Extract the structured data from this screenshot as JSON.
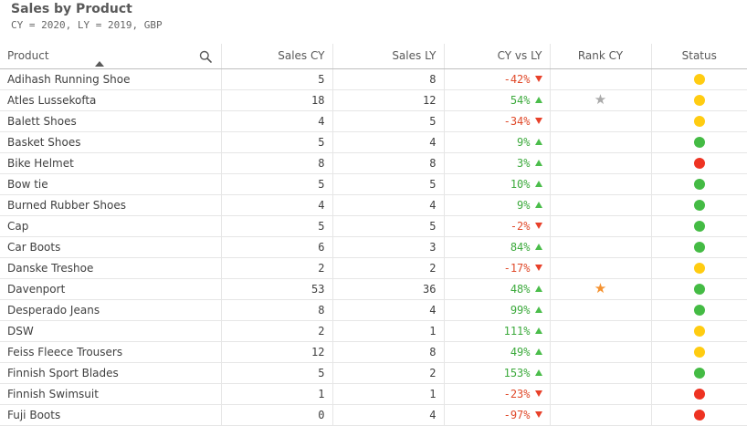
{
  "header": {
    "title": "Sales by Product",
    "subtitle": "CY = 2020, LY = 2019, GBP"
  },
  "columns": [
    "Product",
    "Sales CY",
    "Sales LY",
    "CY vs LY",
    "Rank CY",
    "Status"
  ],
  "icons": {
    "search": "search-icon",
    "sort": "sort-ascending-icon",
    "up": "triangle-up-icon",
    "down": "triangle-down-icon",
    "star": "star-icon"
  },
  "colors": {
    "positive": "#3daa3d",
    "negative": "#e04a2a",
    "status_green": "#44bb44",
    "status_yellow": "#ffcc11",
    "status_red": "#ee3322",
    "star_gold": "#f59230",
    "star_gray": "#aaaaaa"
  },
  "rows": [
    {
      "product": "Adihash Running Shoe",
      "cy": "5",
      "ly": "8",
      "delta": "-42%",
      "trend": "down",
      "rank": "",
      "status": "yellow"
    },
    {
      "product": "Atles Lussekofta",
      "cy": "18",
      "ly": "12",
      "delta": "54%",
      "trend": "up",
      "rank": "gray",
      "status": "yellow"
    },
    {
      "product": "Balett Shoes",
      "cy": "4",
      "ly": "5",
      "delta": "-34%",
      "trend": "down",
      "rank": "",
      "status": "yellow"
    },
    {
      "product": "Basket Shoes",
      "cy": "5",
      "ly": "4",
      "delta": "9%",
      "trend": "up",
      "rank": "",
      "status": "green"
    },
    {
      "product": "Bike Helmet",
      "cy": "8",
      "ly": "8",
      "delta": "3%",
      "trend": "up",
      "rank": "",
      "status": "red"
    },
    {
      "product": "Bow tie",
      "cy": "5",
      "ly": "5",
      "delta": "10%",
      "trend": "up",
      "rank": "",
      "status": "green"
    },
    {
      "product": "Burned Rubber Shoes",
      "cy": "4",
      "ly": "4",
      "delta": "9%",
      "trend": "up",
      "rank": "",
      "status": "green"
    },
    {
      "product": "Cap",
      "cy": "5",
      "ly": "5",
      "delta": "-2%",
      "trend": "down",
      "rank": "",
      "status": "green"
    },
    {
      "product": "Car Boots",
      "cy": "6",
      "ly": "3",
      "delta": "84%",
      "trend": "up",
      "rank": "",
      "status": "green"
    },
    {
      "product": "Danske Treshoe",
      "cy": "2",
      "ly": "2",
      "delta": "-17%",
      "trend": "down",
      "rank": "",
      "status": "yellow"
    },
    {
      "product": "Davenport",
      "cy": "53",
      "ly": "36",
      "delta": "48%",
      "trend": "up",
      "rank": "gold",
      "status": "green"
    },
    {
      "product": "Desperado Jeans",
      "cy": "8",
      "ly": "4",
      "delta": "99%",
      "trend": "up",
      "rank": "",
      "status": "green"
    },
    {
      "product": "DSW",
      "cy": "2",
      "ly": "1",
      "delta": "111%",
      "trend": "up",
      "rank": "",
      "status": "yellow"
    },
    {
      "product": "Feiss Fleece Trousers",
      "cy": "12",
      "ly": "8",
      "delta": "49%",
      "trend": "up",
      "rank": "",
      "status": "yellow"
    },
    {
      "product": "Finnish Sport Blades",
      "cy": "5",
      "ly": "2",
      "delta": "153%",
      "trend": "up",
      "rank": "",
      "status": "green"
    },
    {
      "product": "Finnish Swimsuit",
      "cy": "1",
      "ly": "1",
      "delta": "-23%",
      "trend": "down",
      "rank": "",
      "status": "red"
    },
    {
      "product": "Fuji Boots",
      "cy": "0",
      "ly": "4",
      "delta": "-97%",
      "trend": "down",
      "rank": "",
      "status": "red"
    }
  ]
}
